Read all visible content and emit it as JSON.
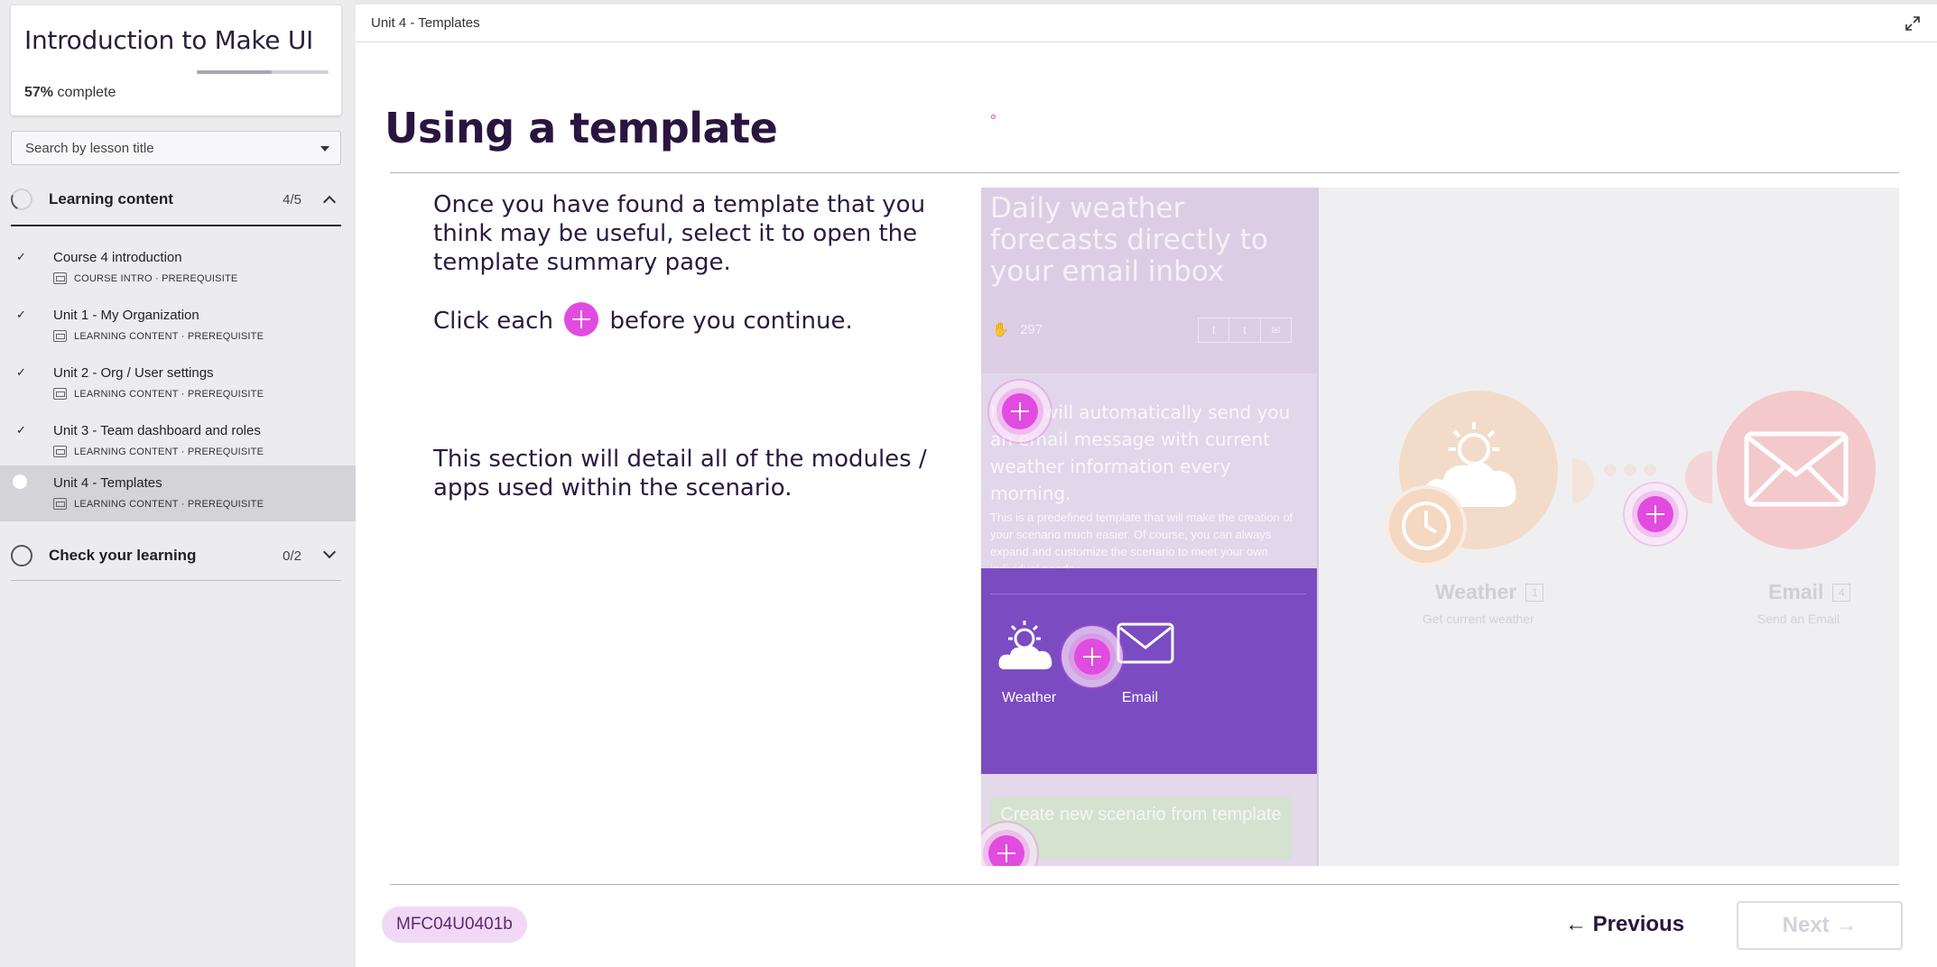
{
  "sidebar": {
    "course_title": "Introduction to Make UI",
    "progress_percent": 57,
    "progress_value": "57%",
    "progress_suffix": " complete",
    "search_placeholder": "Search by lesson title",
    "sections": [
      {
        "title": "Learning content",
        "count": "4/5",
        "expanded": true
      },
      {
        "title": "Check your learning",
        "count": "0/2",
        "expanded": false
      }
    ],
    "lessons": [
      {
        "title": "Course 4 introduction",
        "meta": "COURSE INTRO · PREREQUISITE",
        "completed": true
      },
      {
        "title": "Unit 1 - My Organization",
        "meta": "LEARNING CONTENT · PREREQUISITE",
        "completed": true
      },
      {
        "title": "Unit 2 - Org / User settings",
        "meta": "LEARNING CONTENT · PREREQUISITE",
        "completed": true
      },
      {
        "title": "Unit 3 - Team dashboard and roles",
        "meta": "LEARNING CONTENT · PREREQUISITE",
        "completed": true
      },
      {
        "title": "Unit 4 - Templates",
        "meta": "LEARNING CONTENT · PREREQUISITE",
        "completed": false,
        "active": true
      }
    ]
  },
  "main": {
    "breadcrumb": "Unit 4 - Templates",
    "title": "Using a template",
    "paragraph1": "Once you have found a template that you think may be useful, select it to open the template summary page.",
    "click_prefix": "Click each",
    "click_suffix": "before you continue.",
    "paragraph3": "This section will detail all of the modules / apps used within the scenario.",
    "illustration": {
      "heading": "Daily weather forecasts directly to your email inbox",
      "likes": "297",
      "description_big": "Make will automatically send you an email message with current weather information every morning.",
      "description_small": "This is a predefined template that will make the creation of your scenario much easier. Of course, you can always expand and customize the scenario to meet your own individual needs.",
      "weather_label": "Weather",
      "email_label": "Email",
      "cta": "Create new scenario from template",
      "apps": [
        {
          "name": "Weather",
          "number": "1",
          "subtitle": "Get current weather"
        },
        {
          "name": "Email",
          "number": "4",
          "subtitle": "Send an Email"
        }
      ]
    },
    "code": "MFC04U0401b",
    "prev_label": "Previous",
    "next_label": "Next",
    "accent_color": "#e24be0"
  }
}
